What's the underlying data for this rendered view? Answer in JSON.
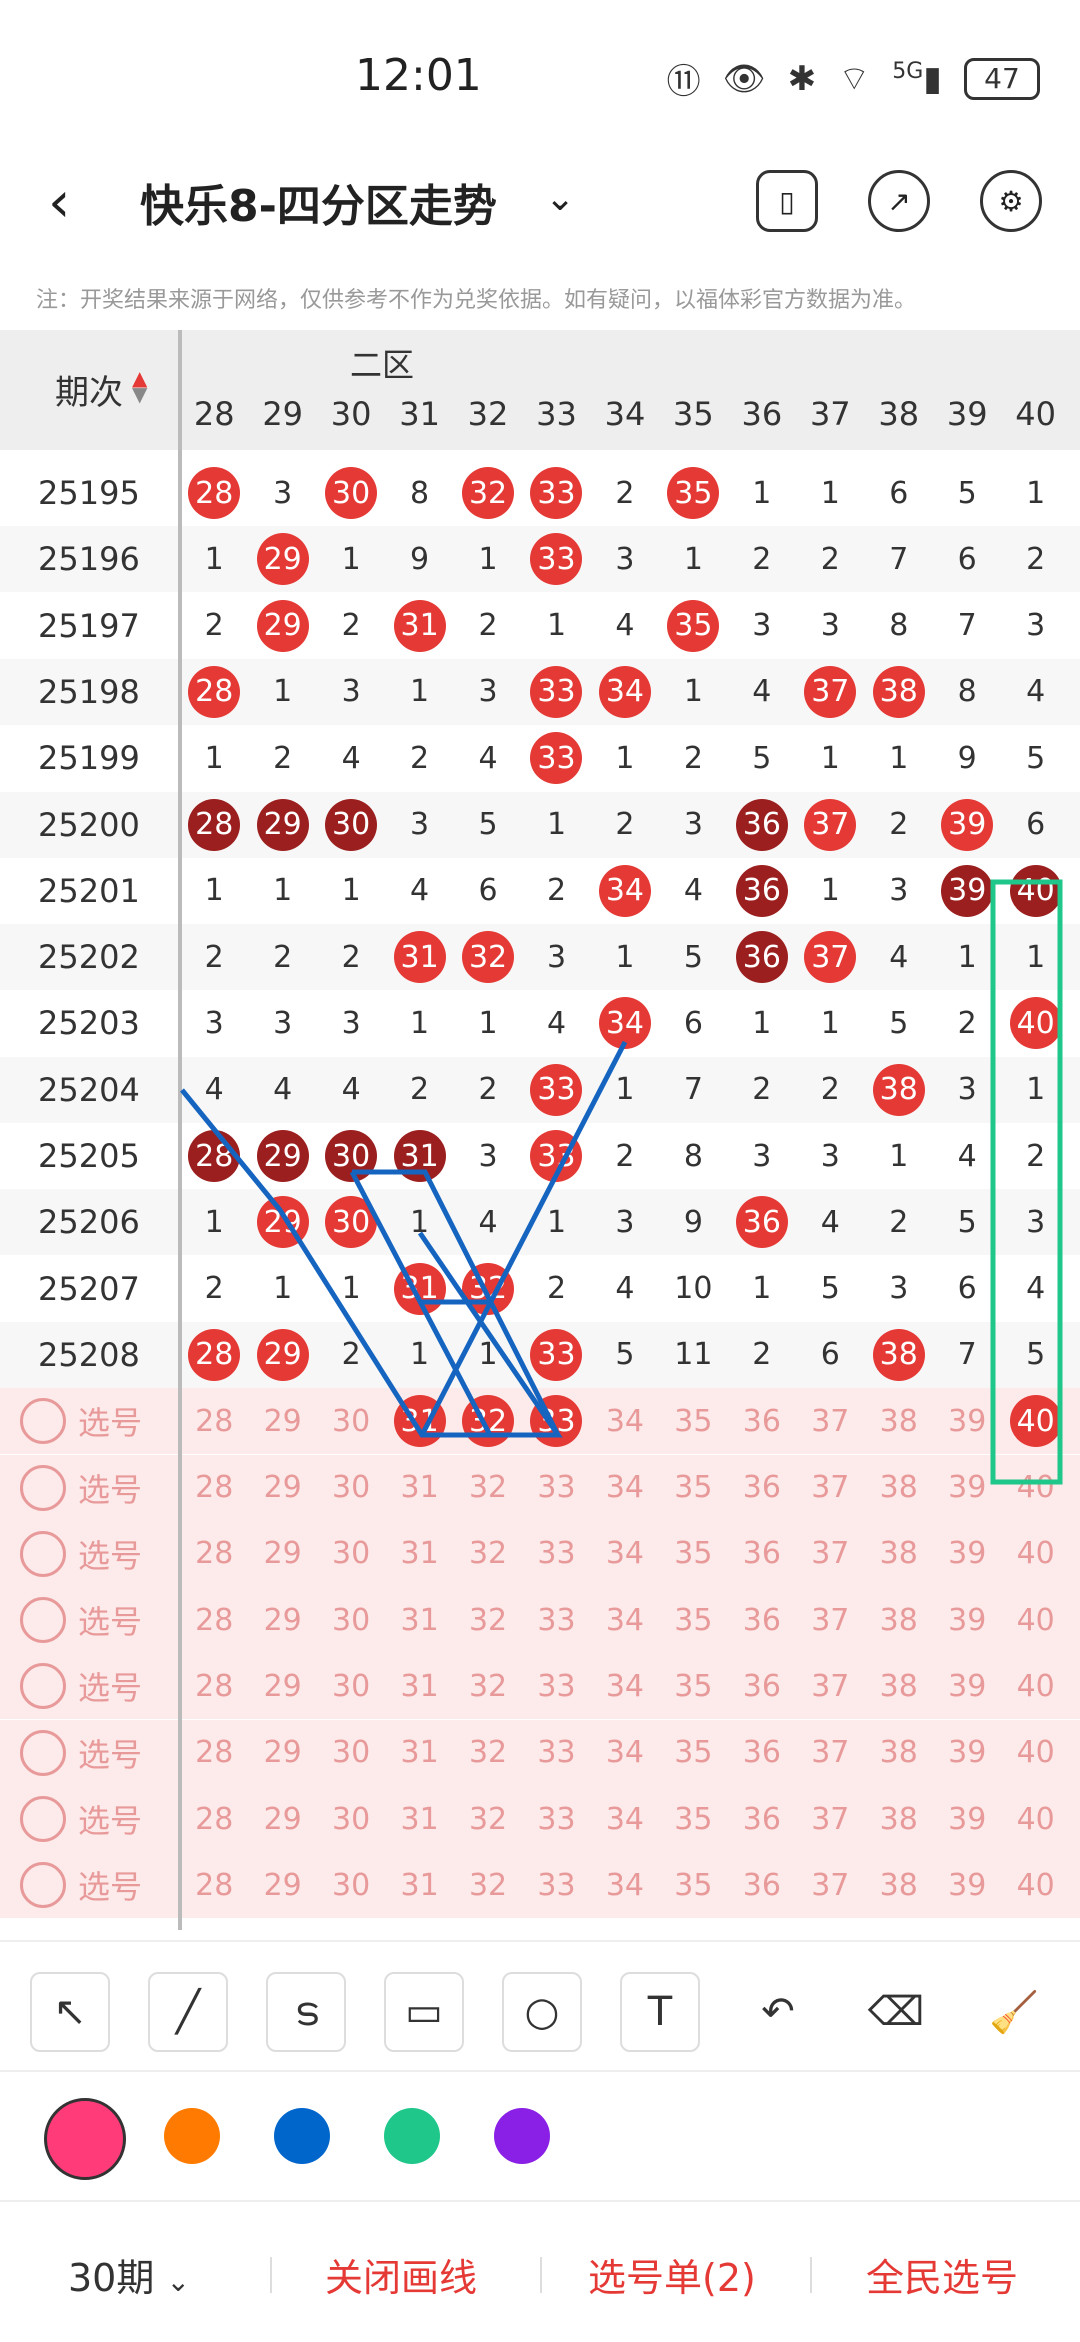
{
  "status": {
    "time": "12:01",
    "battery": "47",
    "net": "5G"
  },
  "header": {
    "title": "快乐8-四分区走势"
  },
  "note": "注：开奖结果来源于网络，仅供参考不作为兑奖依据。如有疑问，以福体彩官方数据为准。",
  "table": {
    "period_label": "期次",
    "zone_title": "二区",
    "columns": [
      "28",
      "29",
      "30",
      "31",
      "32",
      "33",
      "34",
      "35",
      "36",
      "37",
      "38",
      "39",
      "40"
    ],
    "rows": [
      {
        "period": "25195",
        "cells": [
          {
            "v": "28",
            "s": "red"
          },
          {
            "v": "3"
          },
          {
            "v": "30",
            "s": "red"
          },
          {
            "v": "8"
          },
          {
            "v": "32",
            "s": "red"
          },
          {
            "v": "33",
            "s": "red"
          },
          {
            "v": "2"
          },
          {
            "v": "35",
            "s": "red"
          },
          {
            "v": "1"
          },
          {
            "v": "1"
          },
          {
            "v": "6"
          },
          {
            "v": "5"
          },
          {
            "v": "1"
          }
        ]
      },
      {
        "period": "25196",
        "cells": [
          {
            "v": "1"
          },
          {
            "v": "29",
            "s": "red"
          },
          {
            "v": "1"
          },
          {
            "v": "9"
          },
          {
            "v": "1"
          },
          {
            "v": "33",
            "s": "red"
          },
          {
            "v": "3"
          },
          {
            "v": "1"
          },
          {
            "v": "2"
          },
          {
            "v": "2"
          },
          {
            "v": "7"
          },
          {
            "v": "6"
          },
          {
            "v": "2"
          }
        ]
      },
      {
        "period": "25197",
        "cells": [
          {
            "v": "2"
          },
          {
            "v": "29",
            "s": "red"
          },
          {
            "v": "2"
          },
          {
            "v": "31",
            "s": "red"
          },
          {
            "v": "2"
          },
          {
            "v": "1"
          },
          {
            "v": "4"
          },
          {
            "v": "35",
            "s": "red"
          },
          {
            "v": "3"
          },
          {
            "v": "3"
          },
          {
            "v": "8"
          },
          {
            "v": "7"
          },
          {
            "v": "3"
          }
        ]
      },
      {
        "period": "25198",
        "cells": [
          {
            "v": "28",
            "s": "red"
          },
          {
            "v": "1"
          },
          {
            "v": "3"
          },
          {
            "v": "1"
          },
          {
            "v": "3"
          },
          {
            "v": "33",
            "s": "red"
          },
          {
            "v": "34",
            "s": "red"
          },
          {
            "v": "1"
          },
          {
            "v": "4"
          },
          {
            "v": "37",
            "s": "red"
          },
          {
            "v": "38",
            "s": "red"
          },
          {
            "v": "8"
          },
          {
            "v": "4"
          }
        ]
      },
      {
        "period": "25199",
        "cells": [
          {
            "v": "1"
          },
          {
            "v": "2"
          },
          {
            "v": "4"
          },
          {
            "v": "2"
          },
          {
            "v": "4"
          },
          {
            "v": "33",
            "s": "red"
          },
          {
            "v": "1"
          },
          {
            "v": "2"
          },
          {
            "v": "5"
          },
          {
            "v": "1"
          },
          {
            "v": "1"
          },
          {
            "v": "9"
          },
          {
            "v": "5"
          }
        ]
      },
      {
        "period": "25200",
        "cells": [
          {
            "v": "28",
            "s": "dark"
          },
          {
            "v": "29",
            "s": "dark"
          },
          {
            "v": "30",
            "s": "dark"
          },
          {
            "v": "3"
          },
          {
            "v": "5"
          },
          {
            "v": "1"
          },
          {
            "v": "2"
          },
          {
            "v": "3"
          },
          {
            "v": "36",
            "s": "dark"
          },
          {
            "v": "37",
            "s": "red"
          },
          {
            "v": "2"
          },
          {
            "v": "39",
            "s": "red"
          },
          {
            "v": "6"
          }
        ]
      },
      {
        "period": "25201",
        "cells": [
          {
            "v": "1"
          },
          {
            "v": "1"
          },
          {
            "v": "1"
          },
          {
            "v": "4"
          },
          {
            "v": "6"
          },
          {
            "v": "2"
          },
          {
            "v": "34",
            "s": "red"
          },
          {
            "v": "4"
          },
          {
            "v": "36",
            "s": "dark"
          },
          {
            "v": "1"
          },
          {
            "v": "3"
          },
          {
            "v": "39",
            "s": "dark"
          },
          {
            "v": "40",
            "s": "dark"
          }
        ]
      },
      {
        "period": "25202",
        "cells": [
          {
            "v": "2"
          },
          {
            "v": "2"
          },
          {
            "v": "2"
          },
          {
            "v": "31",
            "s": "red"
          },
          {
            "v": "32",
            "s": "red"
          },
          {
            "v": "3"
          },
          {
            "v": "1"
          },
          {
            "v": "5"
          },
          {
            "v": "36",
            "s": "dark"
          },
          {
            "v": "37",
            "s": "red"
          },
          {
            "v": "4"
          },
          {
            "v": "1"
          },
          {
            "v": "1"
          }
        ]
      },
      {
        "period": "25203",
        "cells": [
          {
            "v": "3"
          },
          {
            "v": "3"
          },
          {
            "v": "3"
          },
          {
            "v": "1"
          },
          {
            "v": "1"
          },
          {
            "v": "4"
          },
          {
            "v": "34",
            "s": "red"
          },
          {
            "v": "6"
          },
          {
            "v": "1"
          },
          {
            "v": "1"
          },
          {
            "v": "5"
          },
          {
            "v": "2"
          },
          {
            "v": "40",
            "s": "red"
          }
        ]
      },
      {
        "period": "25204",
        "cells": [
          {
            "v": "4"
          },
          {
            "v": "4"
          },
          {
            "v": "4"
          },
          {
            "v": "2"
          },
          {
            "v": "2"
          },
          {
            "v": "33",
            "s": "red"
          },
          {
            "v": "1"
          },
          {
            "v": "7"
          },
          {
            "v": "2"
          },
          {
            "v": "2"
          },
          {
            "v": "38",
            "s": "red"
          },
          {
            "v": "3"
          },
          {
            "v": "1"
          }
        ]
      },
      {
        "period": "25205",
        "cells": [
          {
            "v": "28",
            "s": "dark"
          },
          {
            "v": "29",
            "s": "dark"
          },
          {
            "v": "30",
            "s": "dark"
          },
          {
            "v": "31",
            "s": "dark"
          },
          {
            "v": "3"
          },
          {
            "v": "33",
            "s": "red"
          },
          {
            "v": "2"
          },
          {
            "v": "8"
          },
          {
            "v": "3"
          },
          {
            "v": "3"
          },
          {
            "v": "1"
          },
          {
            "v": "4"
          },
          {
            "v": "2"
          }
        ]
      },
      {
        "period": "25206",
        "cells": [
          {
            "v": "1"
          },
          {
            "v": "29",
            "s": "red"
          },
          {
            "v": "30",
            "s": "red"
          },
          {
            "v": "1"
          },
          {
            "v": "4"
          },
          {
            "v": "1"
          },
          {
            "v": "3"
          },
          {
            "v": "9"
          },
          {
            "v": "36",
            "s": "red"
          },
          {
            "v": "4"
          },
          {
            "v": "2"
          },
          {
            "v": "5"
          },
          {
            "v": "3"
          }
        ]
      },
      {
        "period": "25207",
        "cells": [
          {
            "v": "2"
          },
          {
            "v": "1"
          },
          {
            "v": "1"
          },
          {
            "v": "31",
            "s": "red"
          },
          {
            "v": "32",
            "s": "red"
          },
          {
            "v": "2"
          },
          {
            "v": "4"
          },
          {
            "v": "10"
          },
          {
            "v": "1"
          },
          {
            "v": "5"
          },
          {
            "v": "3"
          },
          {
            "v": "6"
          },
          {
            "v": "4"
          }
        ]
      },
      {
        "period": "25208",
        "cells": [
          {
            "v": "28",
            "s": "red"
          },
          {
            "v": "29",
            "s": "red"
          },
          {
            "v": "2"
          },
          {
            "v": "1"
          },
          {
            "v": "1"
          },
          {
            "v": "33",
            "s": "red"
          },
          {
            "v": "5"
          },
          {
            "v": "11"
          },
          {
            "v": "2"
          },
          {
            "v": "6"
          },
          {
            "v": "38",
            "s": "red"
          },
          {
            "v": "7"
          },
          {
            "v": "5"
          }
        ]
      }
    ],
    "select_label": "选号",
    "select_rows": 8,
    "first_select_picks": [
      "31",
      "32",
      "33",
      "40"
    ]
  },
  "toolbar": {
    "tools": [
      "arrow-icon",
      "line-icon",
      "curve-icon",
      "rect-icon",
      "circle-icon",
      "text-icon",
      "undo-icon",
      "eraser-icon",
      "clear-icon"
    ],
    "colors": [
      "#ff3b7a",
      "#ff7a00",
      "#0066cc",
      "#1fc78a",
      "#8a1fe6"
    ]
  },
  "bottom": {
    "period": "30期",
    "close_lines": "关闭画线",
    "select_list": "选号单(2)",
    "public_pick": "全民选号"
  }
}
